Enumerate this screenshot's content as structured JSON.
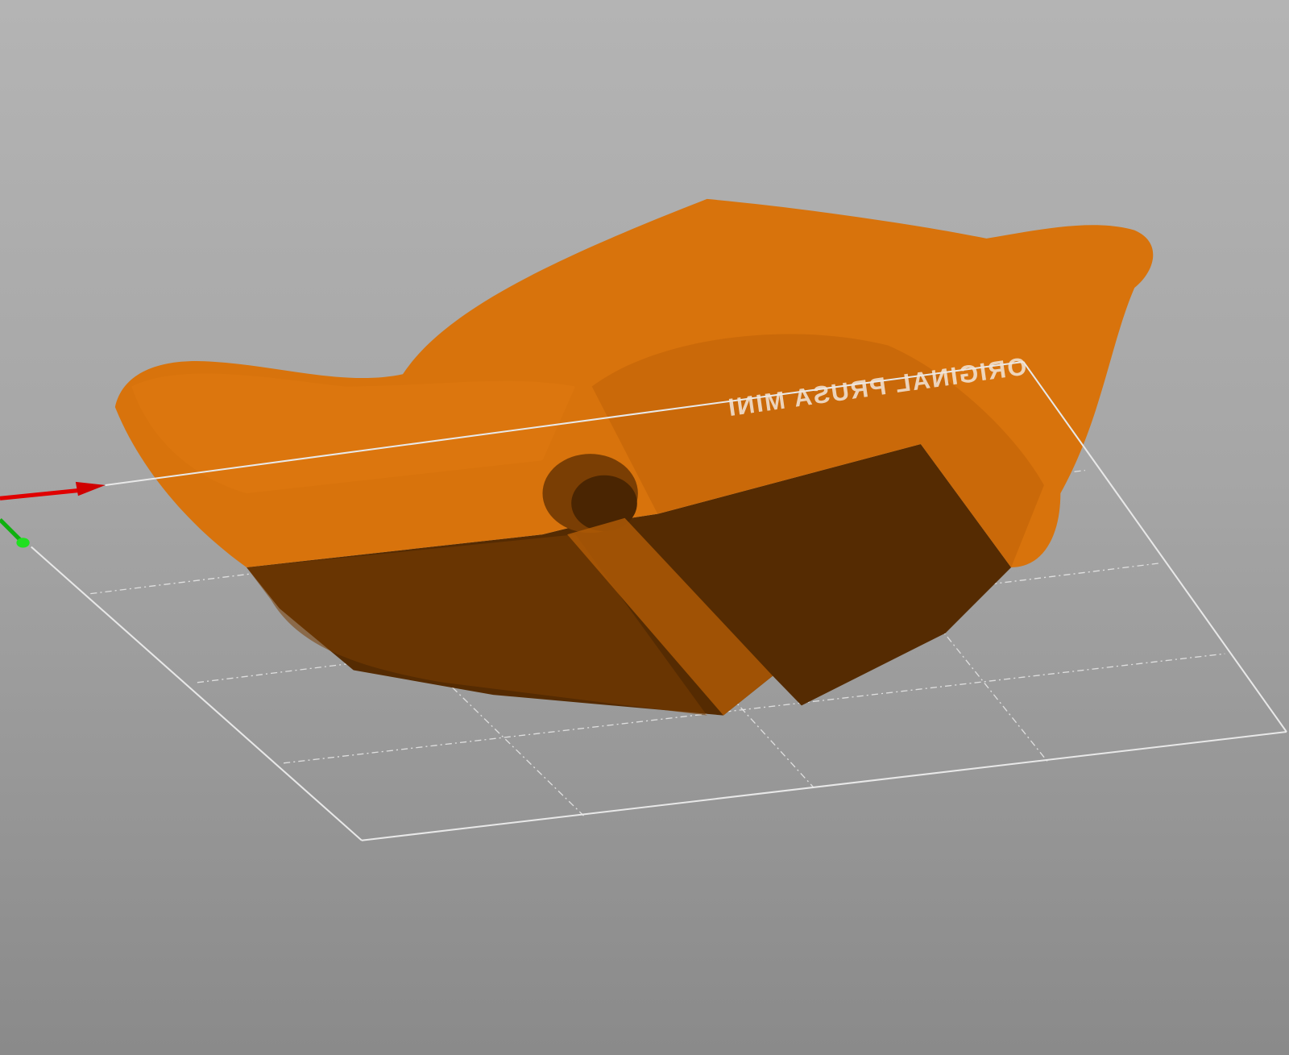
{
  "viewport": {
    "bed_label": "ORIGINAL PRUSA MINI",
    "object_color": "#d8730c",
    "object_shadow_color": "#552b02",
    "axis_x_color": "#e00000",
    "axis_y_color": "#10c010",
    "bed_line_color": "#e8e8e8"
  }
}
